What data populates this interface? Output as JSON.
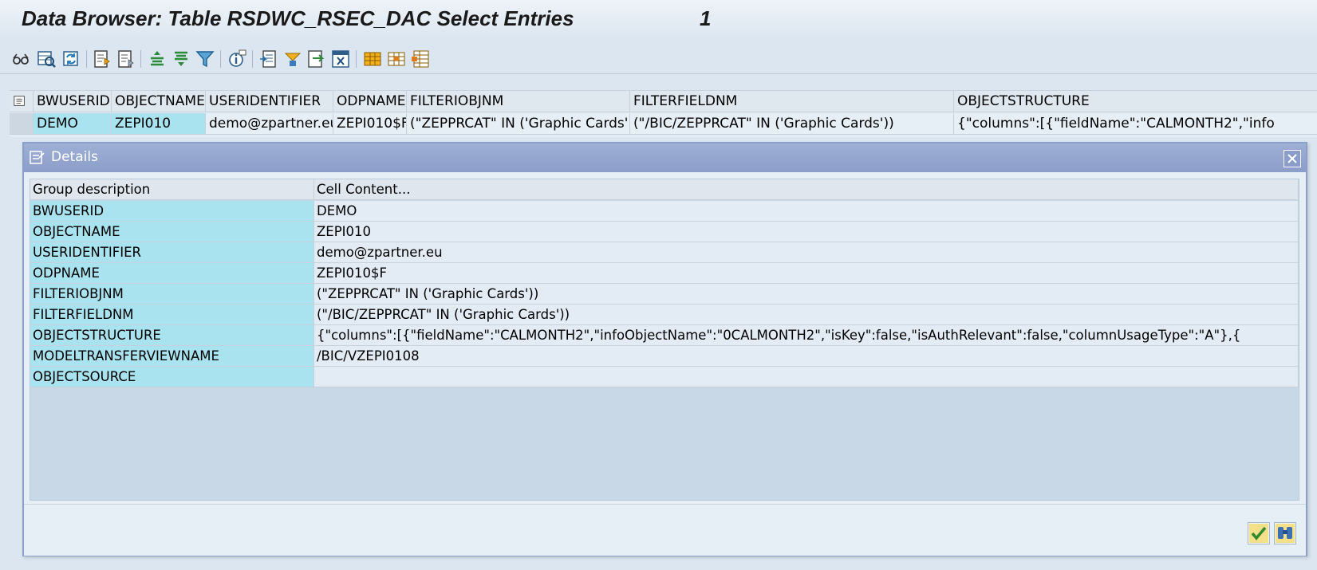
{
  "window": {
    "title": "Data Browser: Table RSDWC_RSEC_DAC Select Entries",
    "entry_count": "1"
  },
  "toolbar": {
    "icons": [
      "glasses-icon",
      "check-table-icon",
      "refresh-icon",
      "details-icon",
      "details-alt-icon",
      "sort-ascending-icon",
      "sort-descending-icon",
      "filter-icon",
      "info-icon",
      "export-icon",
      "change-layout-icon",
      "transfer-icon",
      "print-preview-icon",
      "choose-layout-icon",
      "save-layout-icon",
      "layout-management-icon"
    ]
  },
  "grid": {
    "columns": [
      "BWUSERID",
      "OBJECTNAME",
      "USERIDENTIFIER",
      "ODPNAME",
      "FILTERIOBJNM",
      "FILTERFIELDNM",
      "OBJECTSTRUCTURE"
    ],
    "row": [
      "DEMO",
      "ZEPI010",
      "demo@zpartner.eu",
      "ZEPI010$F",
      "(\"ZEPPRCAT\" IN ('Graphic Cards'))",
      "(\"/BIC/ZEPPRCAT\" IN ('Graphic Cards'))",
      "{\"columns\":[{\"fieldName\":\"CALMONTH2\",\"info"
    ]
  },
  "dialog": {
    "title": "Details",
    "header": {
      "key": "Group description",
      "value": "Cell Content..."
    },
    "rows": [
      {
        "key": "BWUSERID",
        "value": "DEMO"
      },
      {
        "key": "OBJECTNAME",
        "value": "ZEPI010"
      },
      {
        "key": "USERIDENTIFIER",
        "value": "demo@zpartner.eu"
      },
      {
        "key": "ODPNAME",
        "value": "ZEPI010$F"
      },
      {
        "key": "FILTERIOBJNM",
        "value": "(\"ZEPPRCAT\" IN ('Graphic Cards'))"
      },
      {
        "key": "FILTERFIELDNM",
        "value": "(\"/BIC/ZEPPRCAT\" IN ('Graphic Cards'))"
      },
      {
        "key": "OBJECTSTRUCTURE",
        "value": "{\"columns\":[{\"fieldName\":\"CALMONTH2\",\"infoObjectName\":\"0CALMONTH2\",\"isKey\":false,\"isAuthRelevant\":false,\"columnUsageType\":\"A\"},{"
      },
      {
        "key": "MODELTRANSFERVIEWNAME",
        "value": "/BIC/VZEPI0108"
      },
      {
        "key": "OBJECTSOURCE",
        "value": ""
      }
    ],
    "footer_buttons": [
      "continue-check-icon",
      "find-binoculars-icon"
    ]
  },
  "colors": {
    "background": "#dbe6f0",
    "key_cell": "#a9e3f0",
    "dialog_header": "#8b9dc9",
    "value_cell": "#e3ecf5"
  }
}
